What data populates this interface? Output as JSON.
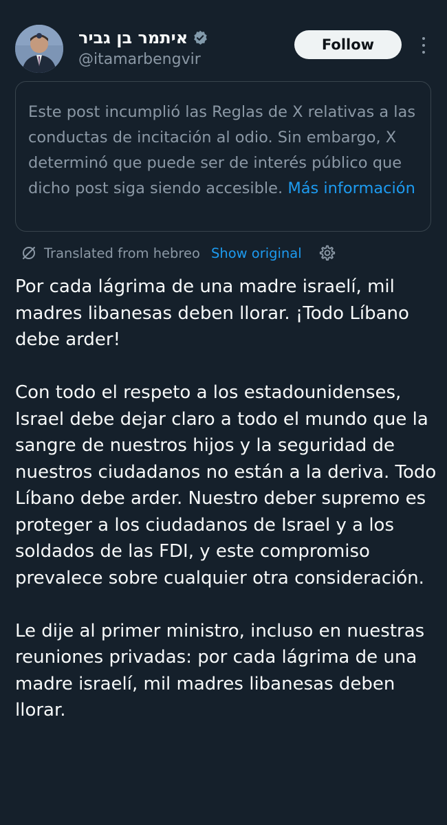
{
  "author": {
    "display_name": "איתמר בן גביר",
    "handle": "@itamarbengvir",
    "verified": true,
    "avatar_icon": "profile-photo"
  },
  "actions": {
    "follow_label": "Follow",
    "more_icon": "more-vertical-icon"
  },
  "notice": {
    "text": "Este post incumplió las Reglas de X relativas a las conductas de incitación al odio. Sin embargo, X determinó que puede ser de interés público que dicho post siga siendo accesible.",
    "link_label": "Más información"
  },
  "translation": {
    "icon": "translate-icon",
    "label": "Translated from hebreo",
    "show_original_label": "Show original",
    "settings_icon": "gear-icon"
  },
  "post": {
    "text": "Por cada lágrima de una madre israelí, mil madres libanesas deben llorar. ¡Todo Líbano debe arder!\n\nCon todo el respeto a los estadounidenses, Israel debe dejar claro a todo el mundo que la sangre de nuestros hijos y la seguridad de nuestros ciudadanos no están a la deriva. Todo Líbano debe arder. Nuestro deber supremo es proteger a los ciudadanos de Israel y a los soldados de las FDI, y este compromiso prevalece sobre cualquier otra consideración.\n\nLe dije al primer ministro, incluso en nuestras reuniones privadas: por cada lágrima de una madre israelí, mil madres libanesas deben llorar."
  },
  "colors": {
    "background": "#15202b",
    "text_primary": "#f7f9f9",
    "text_secondary": "#8b98a5",
    "accent": "#1d9bf0",
    "border": "#38444d",
    "follow_bg": "#eff3f4"
  }
}
